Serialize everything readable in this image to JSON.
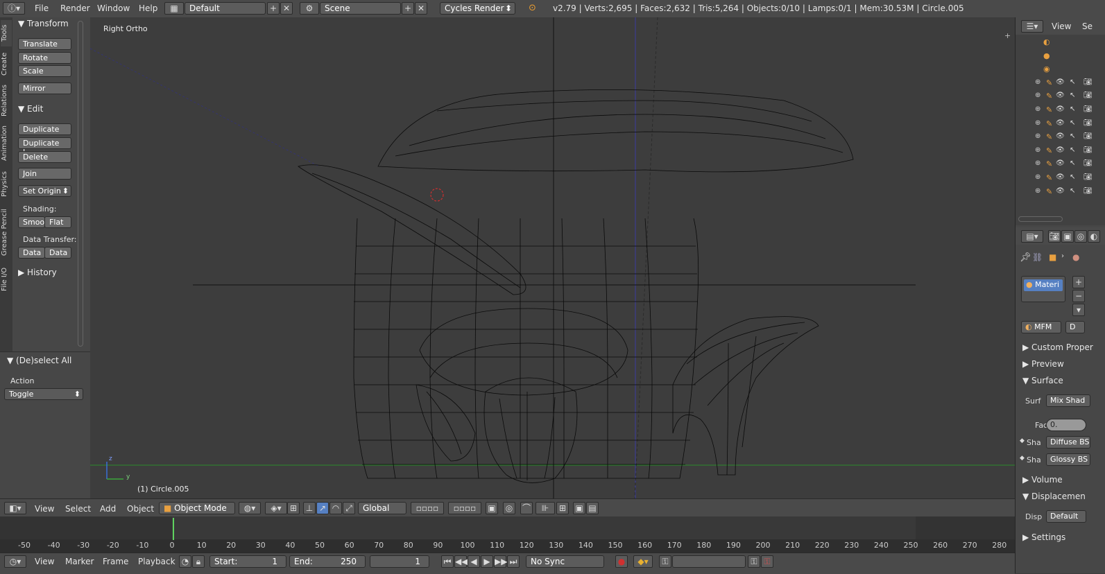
{
  "topbar": {
    "menus": [
      "File",
      "Render",
      "Window",
      "Help"
    ],
    "layout": "Default",
    "scene": "Scene",
    "engine": "Cycles Render",
    "stats": "v2.79 | Verts:2,695 | Faces:2,632 | Tris:5,264 | Objects:0/10 | Lamps:0/1 | Mem:30.53M | Circle.005"
  },
  "tabs": [
    "Tools",
    "Create",
    "Relations",
    "Animation",
    "Physics",
    "Grease Pencil",
    "File I/O"
  ],
  "toolshelf": {
    "transform_header": "Transform",
    "translate": "Translate",
    "rotate": "Rotate",
    "scale": "Scale",
    "mirror": "Mirror",
    "edit_header": "Edit",
    "duplicate": "Duplicate",
    "duplicate_linked": "Duplicate L...",
    "delete": "Delete",
    "join": "Join",
    "set_origin": "Set Origin",
    "shading_label": "Shading:",
    "smooth": "Smoo",
    "flat": "Flat",
    "data_transfer_label": "Data Transfer:",
    "data1": "Data",
    "data2": "Data",
    "history_header": "History"
  },
  "operator": {
    "header": "(De)select All",
    "action_label": "Action",
    "action_value": "Toggle"
  },
  "viewport": {
    "view_name": "Right Ortho",
    "object_info": "(1) Circle.005",
    "axis_z": "z",
    "axis_y": "y"
  },
  "view3d_header": {
    "menus": [
      "View",
      "Select",
      "Add",
      "Object"
    ],
    "mode": "Object Mode",
    "orientation": "Global"
  },
  "timeline": {
    "ticks": [
      -50,
      -40,
      -30,
      -20,
      -10,
      0,
      10,
      20,
      30,
      40,
      50,
      60,
      70,
      80,
      90,
      100,
      110,
      120,
      130,
      140,
      150,
      160,
      170,
      180,
      190,
      200,
      210,
      220,
      230,
      240,
      250,
      260,
      270,
      280
    ],
    "current_frame": 1,
    "menus": [
      "View",
      "Marker",
      "Frame",
      "Playback"
    ],
    "start_label": "Start:",
    "start_value": "1",
    "end_label": "End:",
    "end_value": "250",
    "frame_value": "1",
    "sync": "No Sync"
  },
  "outliner": {
    "view_menu": "View",
    "scene_fragment": "S"
  },
  "properties": {
    "material_slot": "Materi",
    "slot_name": "MFM",
    "data_letter": "D",
    "custom_props": "Custom Proper",
    "preview": "Preview",
    "surface": "Surface",
    "surf_label": "Surf",
    "surf_value": "Mix Shad",
    "fac_label": "Fac",
    "fac_value": "0.",
    "sha1_label": "Sha",
    "sha1_value": "Diffuse BS",
    "sha2_label": "Sha",
    "sha2_value": "Glossy BS",
    "volume": "Volume",
    "displacement": "Displacemen",
    "disp_label": "Disp",
    "disp_value": "Default",
    "settings": "Settings"
  },
  "colors": {
    "x_axis": "#2a8a2a",
    "y_axis": "#3a3aa0",
    "current_frame": "#5fd35f",
    "wire": "#0a0a0a"
  }
}
